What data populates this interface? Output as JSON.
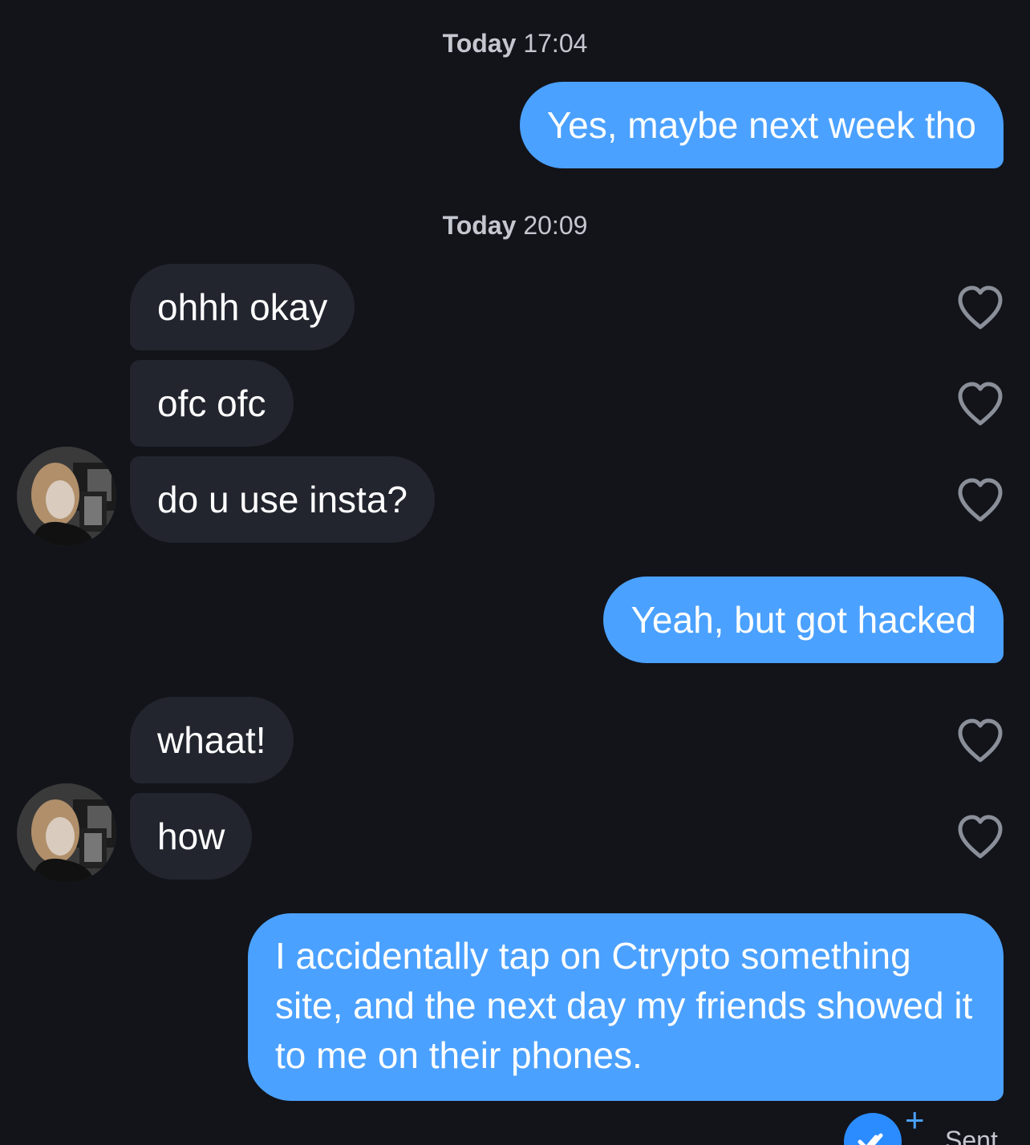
{
  "timestamps": [
    {
      "day": "Today",
      "time": "17:04"
    },
    {
      "day": "Today",
      "time": "20:09"
    }
  ],
  "messages": [
    {
      "from": "me",
      "text": "Yes, maybe next week tho"
    },
    {
      "from": "them",
      "text": "ohhh okay"
    },
    {
      "from": "them",
      "text": "ofc ofc"
    },
    {
      "from": "them",
      "text": "do u use insta?"
    },
    {
      "from": "me",
      "text": "Yeah, but got hacked"
    },
    {
      "from": "them",
      "text": "whaat!"
    },
    {
      "from": "them",
      "text": "how"
    },
    {
      "from": "me",
      "text": "I accidentally tap on Ctrypto something site, and the next day my friends showed it to me on their phones."
    }
  ],
  "status": {
    "label": "Sent",
    "icon": "double-check-icon",
    "extra_icon": "plus-icon"
  },
  "colors": {
    "background": "#12141a",
    "sent_bubble": "#4ba1ff",
    "received_bubble": "#22252e",
    "timestamp": "#c4c7cf",
    "heart_outline": "#8a8f99"
  }
}
